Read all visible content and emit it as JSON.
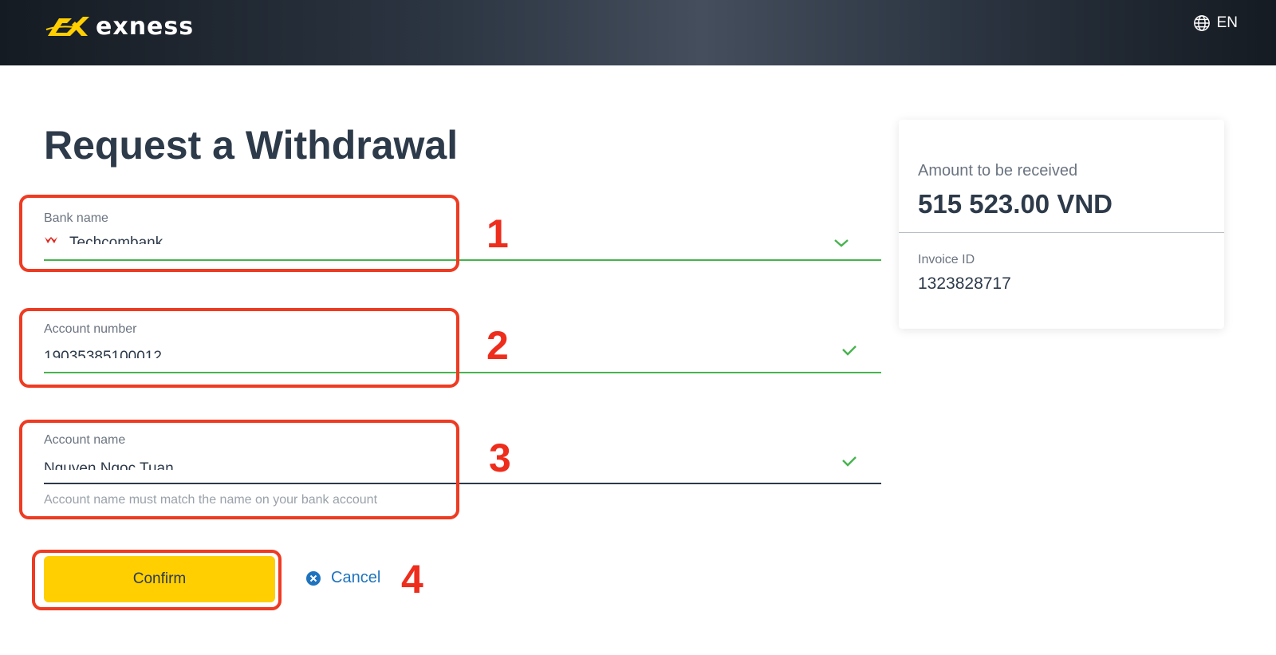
{
  "header": {
    "brand": "exness",
    "language": "EN",
    "icons": {
      "logo": "exness-logo-icon",
      "language": "globe-icon"
    }
  },
  "page": {
    "title": "Request a Withdrawal"
  },
  "form": {
    "bank_name": {
      "label": "Bank name",
      "value": "Techcombank",
      "status_icon": "check-icon"
    },
    "account_number": {
      "label": "Account number",
      "value": "19035385100012",
      "status_icon": "check-icon"
    },
    "account_name": {
      "label": "Account name",
      "value": "Nguyen Ngoc Tuan",
      "hint": "Account name must match the name on your bank account",
      "status_icon": "check-icon"
    },
    "confirm_label": "Confirm",
    "cancel_label": "Cancel"
  },
  "summary": {
    "amount_label": "Amount to be received",
    "amount_value": "515 523.00 VND",
    "invoice_label": "Invoice ID",
    "invoice_value": "1323828717"
  },
  "annotations": {
    "steps": [
      "1",
      "2",
      "3",
      "4"
    ],
    "color": "#ee2d1c"
  },
  "colors": {
    "accent_yellow": "#ffcf01",
    "valid_green": "#46b34e",
    "link_blue": "#1e73be",
    "text_dark": "#2d3a4a"
  }
}
